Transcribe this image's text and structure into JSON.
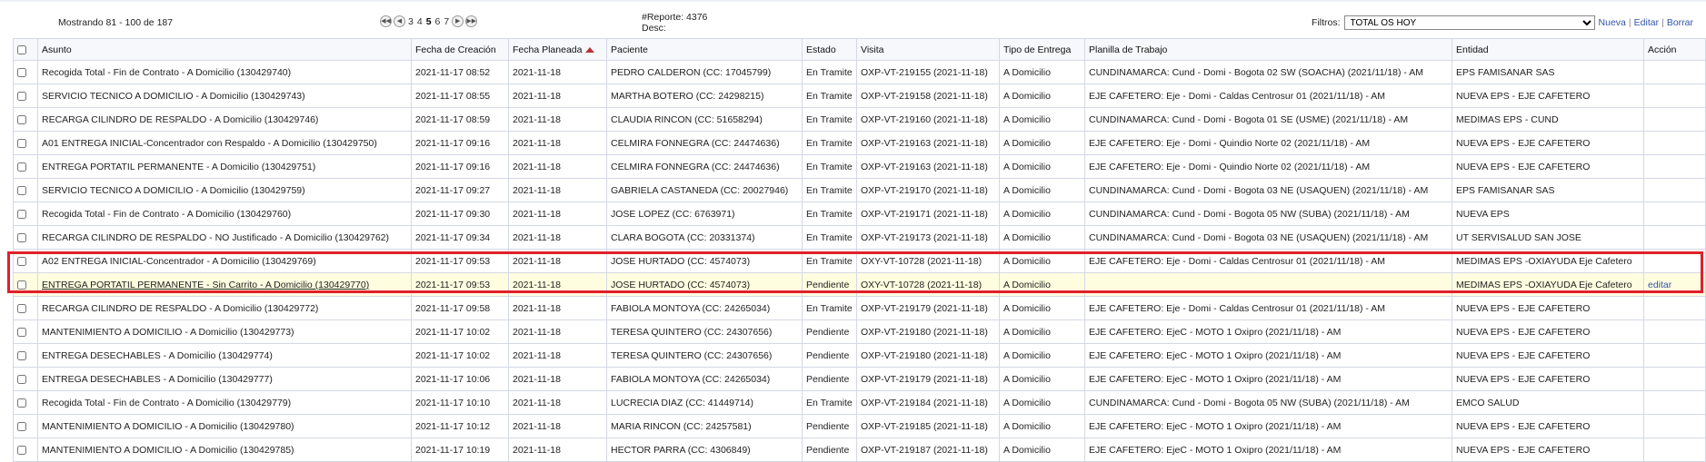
{
  "topbar": {
    "showing": "Mostrando 81 - 100 de 187",
    "pages": [
      "3",
      "4",
      "5",
      "6",
      "7"
    ],
    "current_page": "5",
    "pager_icons": [
      "first-page-icon",
      "prev-page-icon",
      "next-page-icon",
      "last-page-icon"
    ],
    "reporte_line": "#Reporte: 4376",
    "desc_line": "Desc:",
    "filtros_label": "Filtros:",
    "filtro_selected": "TOTAL OS HOY",
    "nueva": "Nueva",
    "editar": "Editar",
    "borrar": "Borrar",
    "link_separator": "|"
  },
  "columns": {
    "asunto": "Asunto",
    "fecha_creacion": "Fecha de Creación",
    "fecha_planeada": "Fecha Planeada",
    "paciente": "Paciente",
    "estado": "Estado",
    "visita": "Visita",
    "tipo_entrega": "Tipo de Entrega",
    "planilla": "Planilla de Trabajo",
    "entidad": "Entidad",
    "accion": "Acción"
  },
  "sorted_column": "fecha_planeada",
  "highlight_color": "#e0202a",
  "rows": [
    {
      "asunto": "Recogida Total - Fin de Contrato - A Domicilio (130429740)",
      "creacion": "2021-11-17 08:52",
      "planeada": "2021-11-18",
      "paciente": "PEDRO CALDERON (CC: 17045799)",
      "estado": "En Tramite",
      "visita": "OXP-VT-219155 (2021-11-18)",
      "tipo": "A Domicilio",
      "planilla": "CUNDINAMARCA: Cund - Domi - Bogota 02 SW (SOACHA) (2021/11/18) - AM",
      "entidad": "EPS FAMISANAR SAS",
      "accion": ""
    },
    {
      "asunto": "SERVICIO TECNICO A DOMICILIO - A Domicilio (130429743)",
      "creacion": "2021-11-17 08:55",
      "planeada": "2021-11-18",
      "paciente": "MARTHA BOTERO (CC: 24298215)",
      "estado": "En Tramite",
      "visita": "OXP-VT-219158 (2021-11-18)",
      "tipo": "A Domicilio",
      "planilla": "EJE CAFETERO: Eje - Domi - Caldas Centrosur 01 (2021/11/18) - AM",
      "entidad": "NUEVA EPS - EJE CAFETERO",
      "accion": ""
    },
    {
      "asunto": "RECARGA CILINDRO DE RESPALDO - A Domicilio (130429746)",
      "creacion": "2021-11-17 08:59",
      "planeada": "2021-11-18",
      "paciente": "CLAUDIA RINCON (CC: 51658294)",
      "estado": "En Tramite",
      "visita": "OXP-VT-219160 (2021-11-18)",
      "tipo": "A Domicilio",
      "planilla": "CUNDINAMARCA: Cund - Domi - Bogota 01 SE (USME) (2021/11/18) - AM",
      "entidad": "MEDIMAS EPS - CUND",
      "accion": ""
    },
    {
      "asunto": "A01 ENTREGA INICIAL-Concentrador con Respaldo - A Domicilio (130429750)",
      "creacion": "2021-11-17 09:16",
      "planeada": "2021-11-18",
      "paciente": "CELMIRA FONNEGRA (CC: 24474636)",
      "estado": "En Tramite",
      "visita": "OXP-VT-219163 (2021-11-18)",
      "tipo": "A Domicilio",
      "planilla": "EJE CAFETERO: Eje - Domi - Quindio Norte 02 (2021/11/18) - AM",
      "entidad": "NUEVA EPS - EJE CAFETERO",
      "accion": ""
    },
    {
      "asunto": "ENTREGA PORTATIL PERMANENTE - A Domicilio (130429751)",
      "creacion": "2021-11-17 09:16",
      "planeada": "2021-11-18",
      "paciente": "CELMIRA FONNEGRA (CC: 24474636)",
      "estado": "En Tramite",
      "visita": "OXP-VT-219163 (2021-11-18)",
      "tipo": "A Domicilio",
      "planilla": "EJE CAFETERO: Eje - Domi - Quindio Norte 02 (2021/11/18) - AM",
      "entidad": "NUEVA EPS - EJE CAFETERO",
      "accion": ""
    },
    {
      "asunto": "SERVICIO TECNICO A DOMICILIO - A Domicilio (130429759)",
      "creacion": "2021-11-17 09:27",
      "planeada": "2021-11-18",
      "paciente": "GABRIELA CASTANEDA (CC: 20027946)",
      "estado": "En Tramite",
      "visita": "OXP-VT-219170 (2021-11-18)",
      "tipo": "A Domicilio",
      "planilla": "CUNDINAMARCA: Cund - Domi - Bogota 03 NE (USAQUEN) (2021/11/18) - AM",
      "entidad": "EPS FAMISANAR SAS",
      "accion": ""
    },
    {
      "asunto": "Recogida Total - Fin de Contrato - A Domicilio (130429760)",
      "creacion": "2021-11-17 09:30",
      "planeada": "2021-11-18",
      "paciente": "JOSE LOPEZ (CC: 6763971)",
      "estado": "En Tramite",
      "visita": "OXP-VT-219171 (2021-11-18)",
      "tipo": "A Domicilio",
      "planilla": "CUNDINAMARCA: Cund - Domi - Bogota 05 NW (SUBA) (2021/11/18) - AM",
      "entidad": "NUEVA EPS",
      "accion": ""
    },
    {
      "asunto": "RECARGA CILINDRO DE RESPALDO - NO Justificado - A Domicilio (130429762)",
      "creacion": "2021-11-17 09:34",
      "planeada": "2021-11-18",
      "paciente": "CLARA BOGOTA (CC: 20331374)",
      "estado": "En Tramite",
      "visita": "OXP-VT-219173 (2021-11-18)",
      "tipo": "A Domicilio",
      "planilla": "CUNDINAMARCA: Cund - Domi - Bogota 03 NE (USAQUEN) (2021/11/18) - AM",
      "entidad": "UT SERVISALUD SAN JOSE",
      "accion": ""
    },
    {
      "asunto": "A02 ENTREGA INICIAL-Concentrador - A Domicilio (130429769)",
      "creacion": "2021-11-17 09:53",
      "planeada": "2021-11-18",
      "paciente": "JOSE HURTADO (CC: 4574073)",
      "estado": "En Tramite",
      "visita": "OXY-VT-10728 (2021-11-18)",
      "tipo": "A Domicilio",
      "planilla": "EJE CAFETERO: Eje - Domi - Caldas Centrosur 01 (2021/11/18) - AM",
      "entidad": "MEDIMAS EPS -OXIAYUDA Eje Cafetero",
      "accion": ""
    },
    {
      "asunto": "ENTREGA PORTATIL PERMANENTE - Sin Carrito - A Domicilio (130429770)",
      "creacion": "2021-11-17 09:53",
      "planeada": "2021-11-18",
      "paciente": "JOSE HURTADO (CC: 4574073)",
      "estado": "Pendiente",
      "visita": "OXY-VT-10728 (2021-11-18)",
      "tipo": "A Domicilio",
      "planilla": "",
      "entidad": "MEDIMAS EPS -OXIAYUDA Eje Cafetero",
      "accion": "editar",
      "highlighted": true
    },
    {
      "asunto": "RECARGA CILINDRO DE RESPALDO - A Domicilio (130429772)",
      "creacion": "2021-11-17 09:58",
      "planeada": "2021-11-18",
      "paciente": "FABIOLA MONTOYA (CC: 24265034)",
      "estado": "En Tramite",
      "visita": "OXP-VT-219179 (2021-11-18)",
      "tipo": "A Domicilio",
      "planilla": "EJE CAFETERO: Eje - Domi - Caldas Centrosur 01 (2021/11/18) - AM",
      "entidad": "NUEVA EPS - EJE CAFETERO",
      "accion": ""
    },
    {
      "asunto": "MANTENIMIENTO A DOMICILIO - A Domicilio (130429773)",
      "creacion": "2021-11-17 10:02",
      "planeada": "2021-11-18",
      "paciente": "TERESA QUINTERO (CC: 24307656)",
      "estado": "Pendiente",
      "visita": "OXP-VT-219180 (2021-11-18)",
      "tipo": "A Domicilio",
      "planilla": "EJE CAFETERO: EjeC - MOTO 1 Oxipro (2021/11/18) - AM",
      "entidad": "NUEVA EPS - EJE CAFETERO",
      "accion": ""
    },
    {
      "asunto": "ENTREGA DESECHABLES - A Domicilio (130429774)",
      "creacion": "2021-11-17 10:02",
      "planeada": "2021-11-18",
      "paciente": "TERESA QUINTERO (CC: 24307656)",
      "estado": "Pendiente",
      "visita": "OXP-VT-219180 (2021-11-18)",
      "tipo": "A Domicilio",
      "planilla": "EJE CAFETERO: EjeC - MOTO 1 Oxipro (2021/11/18) - AM",
      "entidad": "NUEVA EPS - EJE CAFETERO",
      "accion": ""
    },
    {
      "asunto": "ENTREGA DESECHABLES - A Domicilio (130429777)",
      "creacion": "2021-11-17 10:06",
      "planeada": "2021-11-18",
      "paciente": "FABIOLA MONTOYA (CC: 24265034)",
      "estado": "Pendiente",
      "visita": "OXP-VT-219179 (2021-11-18)",
      "tipo": "A Domicilio",
      "planilla": "EJE CAFETERO: EjeC - MOTO 1 Oxipro (2021/11/18) - AM",
      "entidad": "NUEVA EPS - EJE CAFETERO",
      "accion": ""
    },
    {
      "asunto": "Recogida Total - Fin de Contrato - A Domicilio (130429779)",
      "creacion": "2021-11-17 10:10",
      "planeada": "2021-11-18",
      "paciente": "LUCRECIA DIAZ (CC: 41449714)",
      "estado": "En Tramite",
      "visita": "OXP-VT-219184 (2021-11-18)",
      "tipo": "A Domicilio",
      "planilla": "CUNDINAMARCA: Cund - Domi - Bogota 05 NW (SUBA) (2021/11/18) - AM",
      "entidad": "EMCO SALUD",
      "accion": ""
    },
    {
      "asunto": "MANTENIMIENTO A DOMICILIO - A Domicilio (130429780)",
      "creacion": "2021-11-17 10:12",
      "planeada": "2021-11-18",
      "paciente": "MARIA RINCON (CC: 24257581)",
      "estado": "Pendiente",
      "visita": "OXP-VT-219185 (2021-11-18)",
      "tipo": "A Domicilio",
      "planilla": "EJE CAFETERO: EjeC - MOTO 1 Oxipro (2021/11/18) - AM",
      "entidad": "NUEVA EPS - EJE CAFETERO",
      "accion": ""
    },
    {
      "asunto": "MANTENIMIENTO A DOMICILIO - A Domicilio (130429785)",
      "creacion": "2021-11-17 10:19",
      "planeada": "2021-11-18",
      "paciente": "HECTOR PARRA (CC: 4306849)",
      "estado": "Pendiente",
      "visita": "OXP-VT-219187 (2021-11-18)",
      "tipo": "A Domicilio",
      "planilla": "EJE CAFETERO: EjeC - MOTO 1 Oxipro (2021/11/18) - AM",
      "entidad": "NUEVA EPS - EJE CAFETERO",
      "accion": ""
    }
  ]
}
